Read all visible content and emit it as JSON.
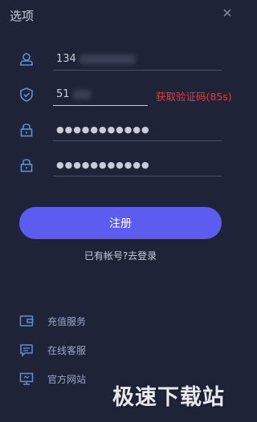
{
  "window": {
    "title": "选项"
  },
  "form": {
    "username_value": "134",
    "code_value": "51",
    "password_value": "●●●●●●●●●●●",
    "confirm_password_value": "●●●●●●●●●●●",
    "get_code_label": "获取验证码(85s)",
    "register_label": "注册",
    "login_link_label": "已有帐号?去登录"
  },
  "menu": {
    "items": [
      {
        "label": "充值服务",
        "icon": "wallet-icon"
      },
      {
        "label": "在线客服",
        "icon": "chat-icon"
      },
      {
        "label": "官方网站",
        "icon": "monitor-icon"
      }
    ]
  },
  "watermark": {
    "text": "极速下载站"
  },
  "colors": {
    "background": "#1f2338",
    "accent": "#5d5cf0",
    "icon": "#5d8fd8",
    "countdown": "#e53a3a"
  }
}
